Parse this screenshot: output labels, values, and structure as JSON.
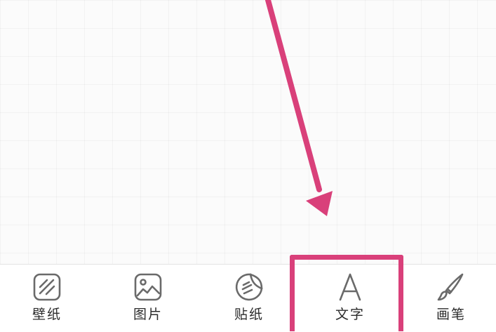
{
  "toolbar": {
    "items": [
      {
        "label": "壁纸",
        "icon": "wallpaper-icon"
      },
      {
        "label": "图片",
        "icon": "image-icon"
      },
      {
        "label": "贴纸",
        "icon": "sticker-icon"
      },
      {
        "label": "文字",
        "icon": "text-icon"
      },
      {
        "label": "画笔",
        "icon": "brush-icon"
      }
    ],
    "highlighted_index": 3
  },
  "annotation": {
    "color": "#d9407a"
  }
}
